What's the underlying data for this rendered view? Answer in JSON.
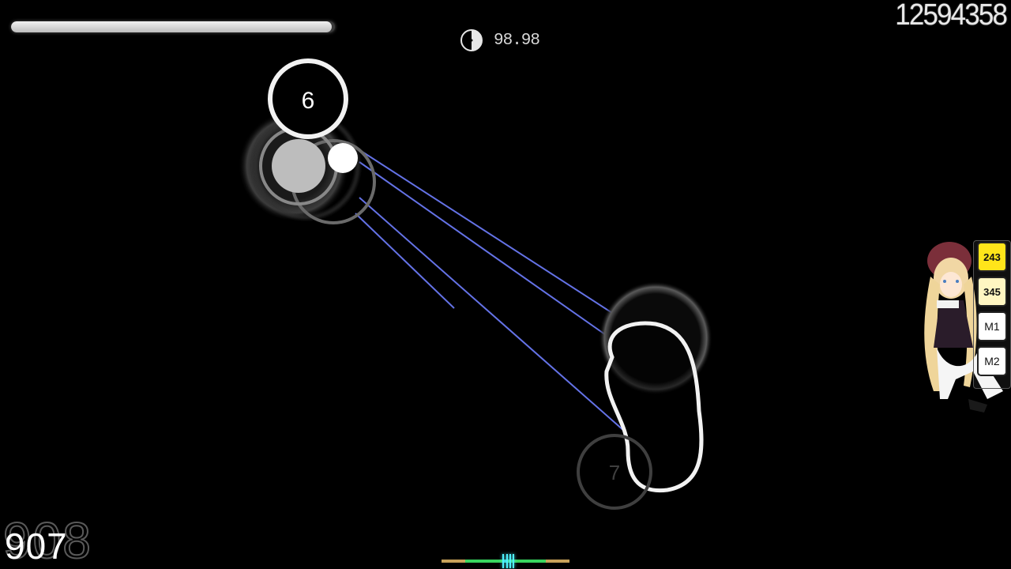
{
  "hud": {
    "score": "12594358",
    "accuracy": "98.98",
    "combo": "907",
    "combo_ghost": "908",
    "hp": 0.99
  },
  "playfield": {
    "hit_circle_number": "6",
    "approaching_circle_number": "7"
  },
  "key_overlay": {
    "k1": "243",
    "k2": "345",
    "m1": "M1",
    "m2": "M2"
  },
  "colors": {
    "key_active": "#ffe51a",
    "key_light": "#fff6c2",
    "follow_line": "#6f7fff",
    "hit_error_great": "#39d45f",
    "hit_error_ok": "#c8a15a",
    "hit_error_mark": "#4ff2ff"
  },
  "icons": {
    "accuracy_pie": "pie-chart-icon",
    "character": "anime-mascot-figure"
  }
}
